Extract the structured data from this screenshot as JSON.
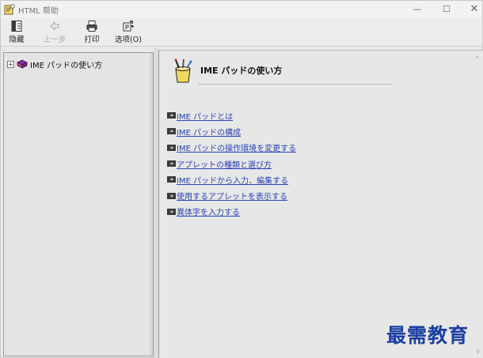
{
  "window": {
    "title": "HTML 帮助",
    "controls": {
      "minimize": "—",
      "maximize": "☐",
      "close": "✕"
    }
  },
  "toolbar": {
    "hide_label": "隐藏",
    "back_label": "上一步",
    "print_label": "打印",
    "options_label": "选项(O)"
  },
  "nav": {
    "tree": [
      {
        "expander": "+",
        "icon": "book-icon",
        "label": "IME パッドの使い方"
      }
    ]
  },
  "content": {
    "title": "IME パッドの使い方",
    "link_icon_text": "»",
    "links": [
      "IME パッドとは",
      "IME パッドの構成",
      "IME パッドの操作環境を変更する",
      "アプレットの種類と選び方",
      "IME パッドから入力、編集する",
      "使用するアプレットを表示する",
      "異体字を入力する"
    ]
  },
  "watermark": "最需教育",
  "colors": {
    "link": "#2a44b8",
    "watermark": "#1b3fa3",
    "background": "#e9e9e9"
  }
}
